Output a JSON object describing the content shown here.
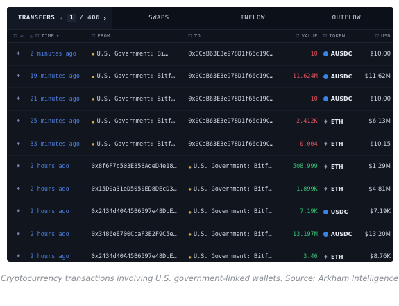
{
  "tabs": {
    "transfers": "TRANSFERS",
    "page_current": "1",
    "page_total": "/ 406",
    "swaps": "SWAPS",
    "inflow": "INFLOW",
    "outflow": "OUTFLOW"
  },
  "columns": {
    "time": "TIME",
    "from": "FROM",
    "to": "TO",
    "value": "VALUE",
    "token": "TOKEN",
    "usd": "USD"
  },
  "rows": [
    {
      "time": "2 minutes ago",
      "from": "U.S. Government: Bi…",
      "to": "0x0CaB63E3e978D1f66c19C…",
      "value": "10",
      "token": "AUSDC",
      "usd": "$10.00"
    },
    {
      "time": "19 minutes ago",
      "from": "U.S. Government: Bitf…",
      "to": "0x0CaB63E3e978D1f66c19C…",
      "value": "11.624M",
      "token": "AUSDC",
      "usd": "$11.62M"
    },
    {
      "time": "21 minutes ago",
      "from": "U.S. Government: Bitf…",
      "to": "0x0CaB63E3e978D1f66c19C…",
      "value": "10",
      "token": "AUSDC",
      "usd": "$10.00"
    },
    {
      "time": "25 minutes ago",
      "from": "U.S. Government: Bitf…",
      "to": "0x0CaB63E3e978D1f66c19C…",
      "value": "2.412K",
      "token": "ETH",
      "usd": "$6.13M"
    },
    {
      "time": "33 minutes ago",
      "from": "U.S. Government: Bitf…",
      "to": "0x0CaB63E3e978D1f66c19C…",
      "value": "0.004",
      "token": "ETH",
      "usd": "$10.15"
    },
    {
      "time": "2 hours ago",
      "from": "0x8f6F7c503E858AdeD4e18…",
      "to": "U.S. Government: Bitf…",
      "value": "508.999",
      "token": "ETH",
      "usd": "$1.29M"
    },
    {
      "time": "2 hours ago",
      "from": "0x15D0a31eD5050ED8DEcD3…",
      "to": "U.S. Government: Bitf…",
      "value": "1.899K",
      "token": "ETH",
      "usd": "$4.81M"
    },
    {
      "time": "2 hours ago",
      "from": "0x2434d40A45B6597e48DbE…",
      "to": "U.S. Government: Bitf…",
      "value": "7.19K",
      "token": "USDC",
      "usd": "$7.19K"
    },
    {
      "time": "2 hours ago",
      "from": "0x3486eE700CcaF3E2F9C5e…",
      "to": "U.S. Government: Bitf…",
      "value": "13.197M",
      "token": "AUSDC",
      "usd": "$13.20M"
    },
    {
      "time": "2 hours ago",
      "from": "0x2434d40A45B6597e48DbE…",
      "to": "U.S. Government: Bitf…",
      "value": "3.46",
      "token": "ETH",
      "usd": "$8.76K"
    }
  ],
  "caption": "Cryptocurrency transactions involving U.S. government-linked wallets. Source: Arkham Intelligence",
  "colors": {
    "outflow": "#e0525c",
    "inflow": "#38c172",
    "time_link": "#4f7fe0",
    "token_dot": "#3a84e8"
  }
}
